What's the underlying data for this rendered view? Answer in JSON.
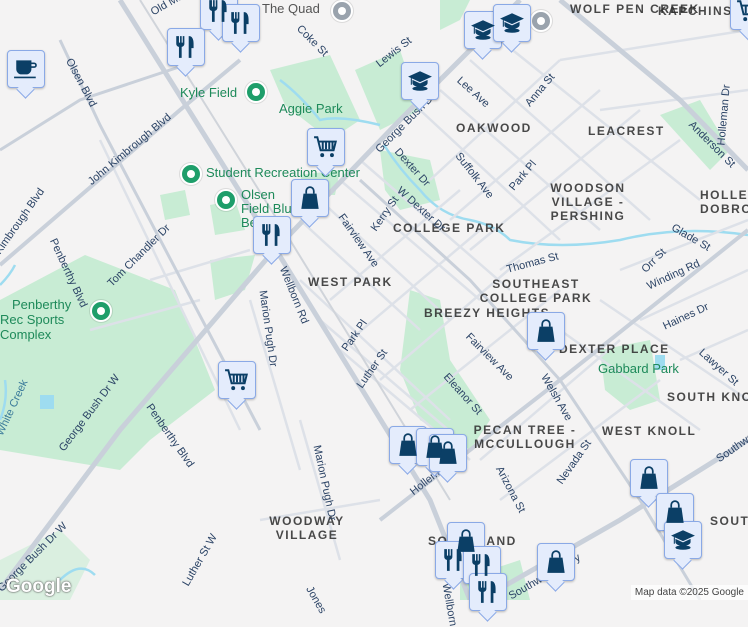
{
  "map": {
    "colors": {
      "background": "#f4f3f3",
      "park": "#c8ecd4",
      "water": "#9edcf0",
      "road": "#dde1e8",
      "major_road": "#c9d0da",
      "pin_fill": "#e4ecfc",
      "pin_border": "#8aa9e6",
      "icon": "#0b3f66",
      "poi_green": "#1e8a5a"
    },
    "pois": [
      "The Quad",
      "Kyle Field",
      "Aggie Park",
      "Student Recreation Center",
      "Olsen Field Blue Bell",
      "Penberthy Rec Sports Complex",
      "Gabbard Park"
    ],
    "neighborhoods": [
      "WOLF PEN CREEK",
      "KAPCHINS",
      "OAKWOOD",
      "LEACREST",
      "WOODSON VILLAGE - PERSHING",
      "HOLLE DOBRO",
      "COLLEGE PARK",
      "WEST PARK",
      "SOUTHEAST COLLEGE PARK",
      "BREEZY HEIGHTS",
      "DEXTER PLACE",
      "SOUTH KNO",
      "PECAN TREE - MCCULLOUGH",
      "WEST KNOLL",
      "SOUT",
      "WOODWAY VILLAGE",
      "SOUTHLAND"
    ],
    "streets": [
      "Old Main Dr",
      "Coke St",
      "Olsen Blvd",
      "John Kimbrough Blvd",
      "Lewis St",
      "George Bush Dr",
      "Lee Ave",
      "Anna St",
      "Anderson St",
      "Holleman Dr",
      "Dexter Dr",
      "Suffolk Ave",
      "Park Pl",
      "W Dexter Dr",
      "Kerry St",
      "Fairview Ave",
      "Thomas St",
      "Glade St",
      "Orr St",
      "Winding Rd",
      "Tom Chandler Dr",
      "Penberthy Blvd",
      "Kimbrough Blvd",
      "Wellborn Rd",
      "Marion Pugh Dr",
      "George Bush Dr W",
      "Park Pl",
      "Luther St",
      "Haines Dr",
      "Lawyer St",
      "Fairview Ave",
      "Eleanor St",
      "Welsh Ave",
      "Nevada St",
      "Arizona St",
      "Holleman Dr",
      "Southwest Pkwy",
      "Marion Pugh Dr",
      "Penberthy Blvd",
      "White Creek",
      "George Bush Dr W",
      "Luther St W",
      "Jones",
      "Southwest Pkwy",
      "Wellborn"
    ],
    "markers": [
      {
        "type": "restaurant",
        "icon": "fork-knife-icon"
      },
      {
        "type": "restaurant",
        "icon": "fork-knife-icon"
      },
      {
        "type": "restaurant",
        "icon": "fork-knife-icon"
      },
      {
        "type": "coffee",
        "icon": "coffee-cup-icon"
      },
      {
        "type": "grocery",
        "icon": "shopping-cart-icon"
      },
      {
        "type": "shopping",
        "icon": "shopping-bag-icon"
      },
      {
        "type": "restaurant",
        "icon": "fork-knife-icon"
      },
      {
        "type": "grocery",
        "icon": "shopping-cart-icon"
      },
      {
        "type": "school",
        "icon": "graduation-cap-icon"
      },
      {
        "type": "school",
        "icon": "graduation-cap-icon"
      },
      {
        "type": "school",
        "icon": "graduation-cap-icon"
      },
      {
        "type": "shopping",
        "icon": "shopping-bag-icon"
      },
      {
        "type": "shopping",
        "icon": "shopping-bag-icon"
      },
      {
        "type": "shopping",
        "icon": "shopping-bag-icon"
      },
      {
        "type": "shopping",
        "icon": "shopping-bag-icon"
      },
      {
        "type": "shopping",
        "icon": "shopping-bag-icon"
      },
      {
        "type": "shopping",
        "icon": "shopping-bag-icon"
      },
      {
        "type": "school",
        "icon": "graduation-cap-icon"
      },
      {
        "type": "shopping",
        "icon": "shopping-bag-icon"
      },
      {
        "type": "restaurant",
        "icon": "fork-knife-icon"
      },
      {
        "type": "restaurant",
        "icon": "fork-knife-icon"
      },
      {
        "type": "restaurant",
        "icon": "fork-knife-icon"
      },
      {
        "type": "shopping",
        "icon": "shopping-bag-icon"
      },
      {
        "type": "grocery",
        "icon": "shopping-cart-icon"
      }
    ],
    "logo": "Google",
    "attribution": "Map data ©2025 Google"
  }
}
